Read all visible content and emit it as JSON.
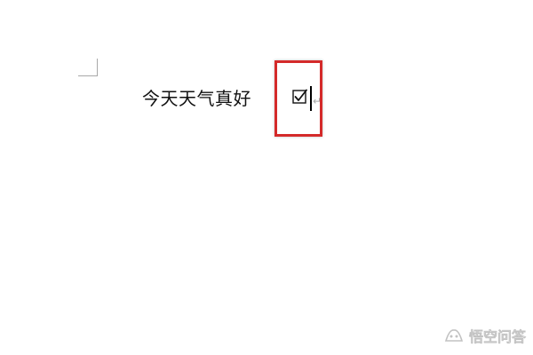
{
  "document": {
    "text": "今天天气真好",
    "inserted_symbol": "☑",
    "paragraph_mark": "↵"
  },
  "watermark": {
    "text": "悟空问答",
    "icon": "wukong-logo-icon"
  },
  "colors": {
    "highlight": "#d42a2a",
    "text": "#111111",
    "formatting_mark": "#a8a8a8"
  }
}
